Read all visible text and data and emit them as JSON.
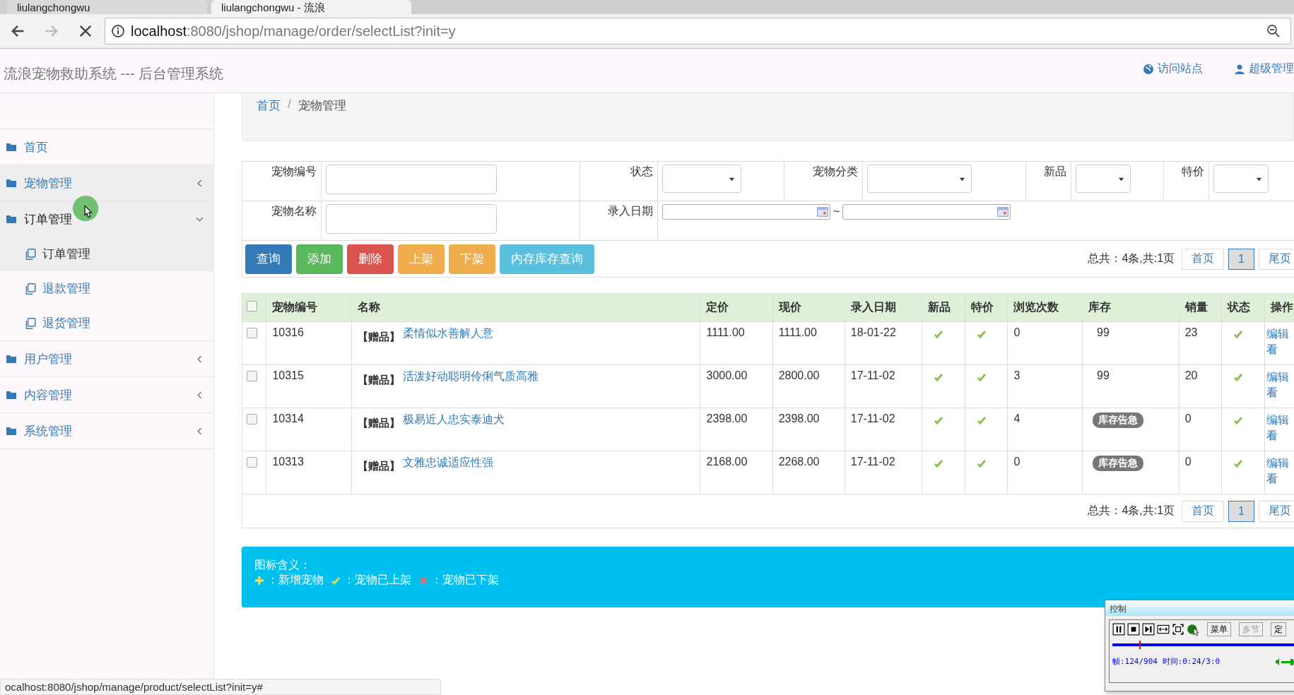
{
  "browser": {
    "tabs": [
      {
        "label": "liulangchongwu",
        "selected": false
      },
      {
        "label": "liulangchongwu - 流浪",
        "selected": true
      }
    ],
    "url": {
      "host": "localhost",
      "path": ":8080/jshop/manage/order/selectList?init=y"
    },
    "status_url": "ocalhost:8080/jshop/manage/product/selectList?init=y#"
  },
  "header": {
    "title": "流浪宠物救助系统 --- 后台管理系统",
    "links": [
      {
        "kind": "globe",
        "label": "访问站点"
      },
      {
        "kind": "user",
        "label": "超级管理"
      }
    ]
  },
  "sidebar": {
    "items": [
      {
        "label": "首页",
        "kind": "link"
      },
      {
        "label": "宠物管理",
        "kind": "menu",
        "expanded": false
      },
      {
        "label": "订单管理",
        "kind": "menu",
        "expanded": true,
        "children": [
          {
            "label": "订单管理",
            "selected": true
          },
          {
            "label": "退款管理",
            "selected": false
          },
          {
            "label": "退货管理",
            "selected": false
          }
        ]
      },
      {
        "label": "用户管理",
        "kind": "menu",
        "expanded": false
      },
      {
        "label": "内容管理",
        "kind": "menu",
        "expanded": false
      },
      {
        "label": "系统管理",
        "kind": "menu",
        "expanded": false
      }
    ]
  },
  "breadcrumb": [
    {
      "label": "首页",
      "kind": "link"
    },
    {
      "label": "/",
      "kind": "separator"
    },
    {
      "label": "宠物管理",
      "kind": "current"
    }
  ],
  "filters": {
    "row_1": [
      {
        "label": "宠物编号",
        "kind": "text"
      },
      {
        "label": "状态",
        "kind": "select"
      },
      {
        "label": "宠物分类",
        "kind": "select"
      },
      {
        "label": "新品",
        "kind": "select"
      },
      {
        "label": "特价",
        "kind": "select"
      }
    ],
    "row_2": [
      {
        "label": "宠物名称",
        "kind": "text"
      },
      {
        "label": "录入日期",
        "kind": "daterange",
        "separator": "~"
      }
    ]
  },
  "buttons": [
    {
      "label": "查询",
      "color": "#337ab7"
    },
    {
      "label": "添加",
      "color": "#5cb85c"
    },
    {
      "label": "删除",
      "color": "#d9534f"
    },
    {
      "label": "上架",
      "color": "#f0ad4e"
    },
    {
      "label": "下架",
      "color": "#f0ad4e"
    },
    {
      "label": "内存库存查询",
      "color": "#5bc0de"
    }
  ],
  "pagination_top": {
    "summary": "总共：4条,共:1页",
    "pages": [
      {
        "label": "首页",
        "selected": false
      },
      {
        "label": "1",
        "selected": true
      },
      {
        "label": "尾页",
        "selected": false
      }
    ]
  },
  "table": {
    "select_all_checked": false,
    "columns": [
      "宠物编号",
      "名称",
      "定价",
      "现价",
      "录入日期",
      "新品",
      "特价",
      "浏览次数",
      "库存",
      "销量",
      "状态",
      "操作"
    ],
    "rows": [
      {
        "checked": false,
        "id": "10316",
        "tag": "【赠品】",
        "name": "柔情似水善解人意",
        "list_price": "1111.00",
        "price": "1111.00",
        "date": "18-01-22",
        "new": true,
        "special": true,
        "views": "0",
        "stock": {
          "kind": "number",
          "text": "99"
        },
        "sales": "23",
        "on_sale": true,
        "actions": [
          "编辑",
          "看"
        ]
      },
      {
        "checked": false,
        "id": "10315",
        "tag": "【赠品】",
        "name": "活泼好动聪明伶俐气质高雅",
        "list_price": "3000.00",
        "price": "2800.00",
        "date": "17-11-02",
        "new": true,
        "special": true,
        "views": "3",
        "stock": {
          "kind": "number",
          "text": "99"
        },
        "sales": "20",
        "on_sale": true,
        "actions": [
          "编辑",
          "看"
        ]
      },
      {
        "checked": false,
        "id": "10314",
        "tag": "【赠品】",
        "name": "极易近人忠实泰迪犬",
        "list_price": "2398.00",
        "price": "2398.00",
        "date": "17-11-02",
        "new": true,
        "special": true,
        "views": "4",
        "stock": {
          "kind": "alert",
          "text": "库存告急"
        },
        "sales": "0",
        "on_sale": true,
        "actions": [
          "编辑",
          "看"
        ]
      },
      {
        "checked": false,
        "id": "10313",
        "tag": "【赠品】",
        "name": "文雅忠诚适应性强",
        "list_price": "2168.00",
        "price": "2268.00",
        "date": "17-11-02",
        "new": true,
        "special": true,
        "views": "0",
        "stock": {
          "kind": "alert",
          "text": "库存告急"
        },
        "sales": "0",
        "on_sale": true,
        "actions": [
          "编辑",
          "看"
        ]
      }
    ]
  },
  "pagination_bottom": {
    "summary": "总共：4条,共:1页",
    "pages": [
      {
        "label": "首页",
        "selected": false
      },
      {
        "label": "1",
        "selected": true
      },
      {
        "label": "尾页",
        "selected": false
      }
    ]
  },
  "legend": {
    "title": "图标含义：",
    "items": [
      {
        "kind": "plus",
        "text": "：新增宠物"
      },
      {
        "kind": "check",
        "text": "：宠物已上架"
      },
      {
        "kind": "cross",
        "text": "：宠物已下架"
      }
    ]
  },
  "recorder": {
    "title": "控制",
    "text_buttons": [
      {
        "label": "菜单",
        "disabled": false
      },
      {
        "label": "多节",
        "disabled": true
      },
      {
        "label": "定",
        "disabled": false
      }
    ],
    "position": {
      "level": 0.14
    },
    "status": "帧:124/904 时间:0:24/3:0"
  }
}
